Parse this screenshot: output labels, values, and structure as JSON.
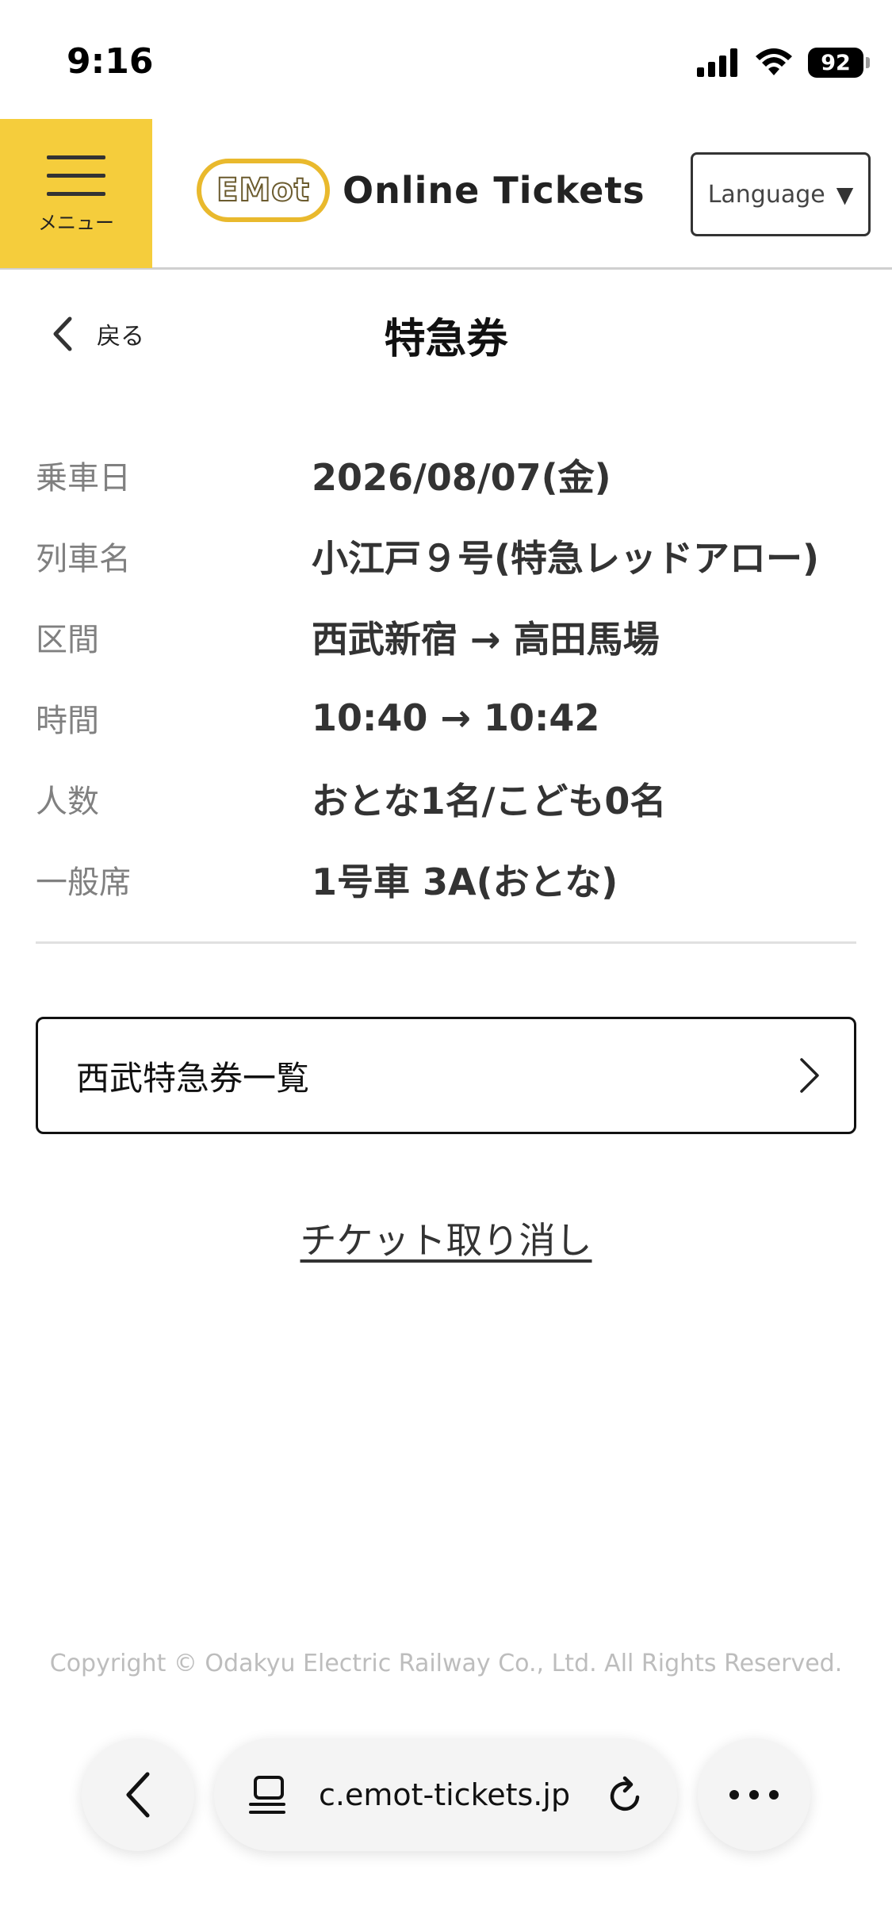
{
  "status_bar": {
    "time": "9:16",
    "battery": "92"
  },
  "header": {
    "menu_label": "メニュー",
    "logo_badge": "EMot",
    "logo_text": "Online Tickets",
    "language_label": "Language",
    "language_caret": "▼"
  },
  "subheader": {
    "back_label": "戻る",
    "title": "特急券"
  },
  "details": [
    {
      "label": "乗車日",
      "value": "2026/08/07(金)"
    },
    {
      "label": "列車名",
      "value": "小江戸９号(特急レッドアロー)"
    },
    {
      "label": "区間",
      "value": "西武新宿 → 高田馬場"
    },
    {
      "label": "時間",
      "value": "10:40 → 10:42"
    },
    {
      "label": "人数",
      "value": "おとな1名/こども0名"
    },
    {
      "label": "一般席",
      "value": "1号車 3A(おとな)"
    }
  ],
  "list_button": {
    "label": "西武特急券一覧"
  },
  "cancel_link": "チケット取り消し",
  "footer": {
    "copyright": "Copyright © Odakyu Electric Railway Co., Ltd. All Rights Reserved."
  },
  "browser": {
    "url": "c.emot-tickets.jp"
  },
  "colors": {
    "accent_yellow": "#f5cd3c",
    "logo_gold": "#e9b92d",
    "label_gray": "#808080"
  }
}
